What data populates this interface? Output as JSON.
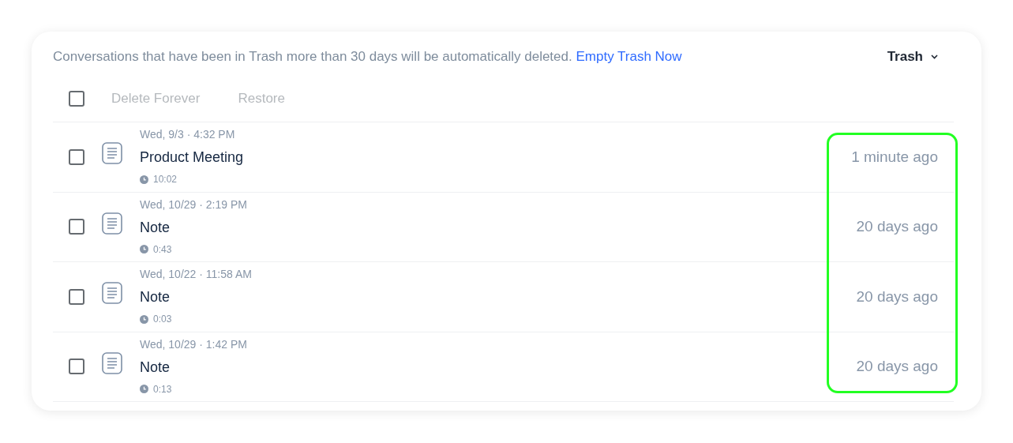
{
  "notice": {
    "text": "Conversations that have been in Trash more than 30 days will be automatically deleted.",
    "link": "Empty Trash Now"
  },
  "folder_menu": {
    "label": "Trash"
  },
  "toolbar": {
    "select_all_checked": false,
    "actions": [
      {
        "label": "Delete Forever",
        "disabled": true
      },
      {
        "label": "Restore",
        "disabled": true
      }
    ]
  },
  "conversations": [
    {
      "checked": false,
      "date": "Wed, 9/3 · 4:32 PM",
      "title": "Product Meeting",
      "duration": "10:02",
      "deleted": "1 minute ago"
    },
    {
      "checked": false,
      "date": "Wed, 10/29 · 2:19 PM",
      "title": "Note",
      "duration": "0:43",
      "deleted": "20 days ago"
    },
    {
      "checked": false,
      "date": "Wed, 10/22 · 11:58 AM",
      "title": "Note",
      "duration": "0:03",
      "deleted": "20 days ago"
    },
    {
      "checked": false,
      "date": "Wed, 10/29 · 1:42 PM",
      "title": "Note",
      "duration": "0:13",
      "deleted": "20 days ago"
    }
  ]
}
